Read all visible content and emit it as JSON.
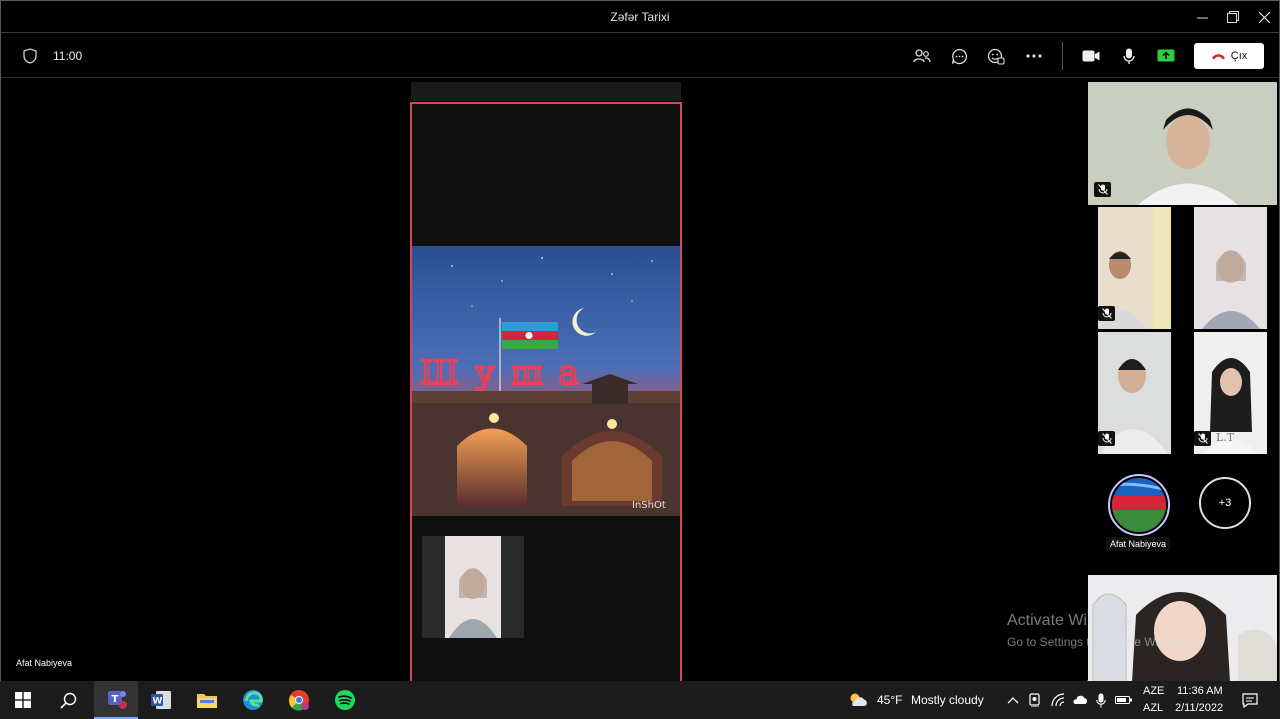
{
  "window": {
    "title": "Zəfər Tarixi"
  },
  "toolbar": {
    "timer": "11:00",
    "leave_label": "Çıx"
  },
  "stage": {
    "presenter_name": "Afat Nabiyeva",
    "shared_image_text": "Шуша",
    "shared_watermark": "InShOt"
  },
  "roster": {
    "avatar_name": "Afat Nabiyeva",
    "more_count": "+3",
    "tile5_glyph": "L.T"
  },
  "watermark": {
    "line1": "Activate Windows",
    "line2": "Go to Settings to activate Windows."
  },
  "taskbar": {
    "weather_temp": "45°F",
    "weather_desc": "Mostly cloudy",
    "lang_top": "AZE",
    "lang_bottom": "AZL",
    "time": "11:36 AM",
    "date": "2/11/2022"
  },
  "colors": {
    "accent_red": "#d6465a",
    "share_on": "#2ecc40",
    "taskbar_bg": "#1c1c1c"
  }
}
